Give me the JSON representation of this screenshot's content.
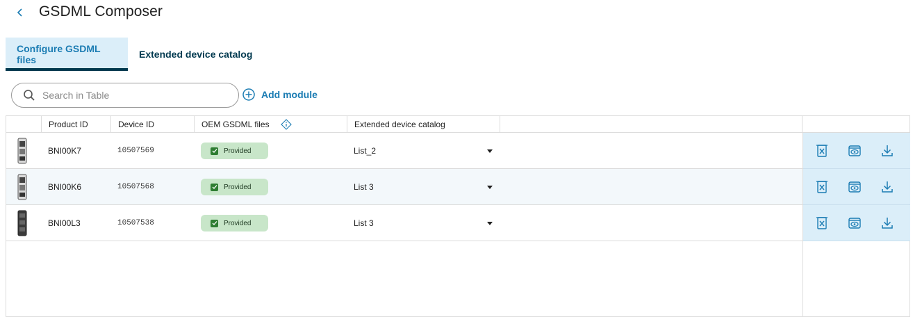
{
  "header": {
    "back_icon": "chevron-left-icon",
    "title": "GSDML Composer"
  },
  "tabs": [
    {
      "label": "Configure GSDML files",
      "active": true
    },
    {
      "label": "Extended device catalog",
      "active": false
    }
  ],
  "search": {
    "placeholder": "Search in Table",
    "value": "",
    "icon": "search-icon"
  },
  "add_module": {
    "label": "Add module",
    "icon": "plus-circle-icon"
  },
  "table": {
    "columns": [
      "",
      "Product ID",
      "Device ID",
      "OEM GSDML files",
      "Extended device catalog"
    ],
    "info_icon": "info-diamond-icon",
    "rows": [
      {
        "product_id": "BNI00K7",
        "device_id": "10507569",
        "oem_status": "Provided",
        "catalog": "List_2"
      },
      {
        "product_id": "BNI00K6",
        "device_id": "10507568",
        "oem_status": "Provided",
        "catalog": "List 3"
      },
      {
        "product_id": "BNI00L3",
        "device_id": "10507538",
        "oem_status": "Provided",
        "catalog": "List 3"
      }
    ],
    "row_actions": [
      "delete-icon",
      "view-icon",
      "download-icon"
    ]
  },
  "colors": {
    "accent": "#1b7cb3",
    "tab_active_bg": "#dbeef9",
    "tab_underline": "#00394f",
    "badge_bg": "#c8e6c9",
    "check_green": "#2e7d32"
  }
}
